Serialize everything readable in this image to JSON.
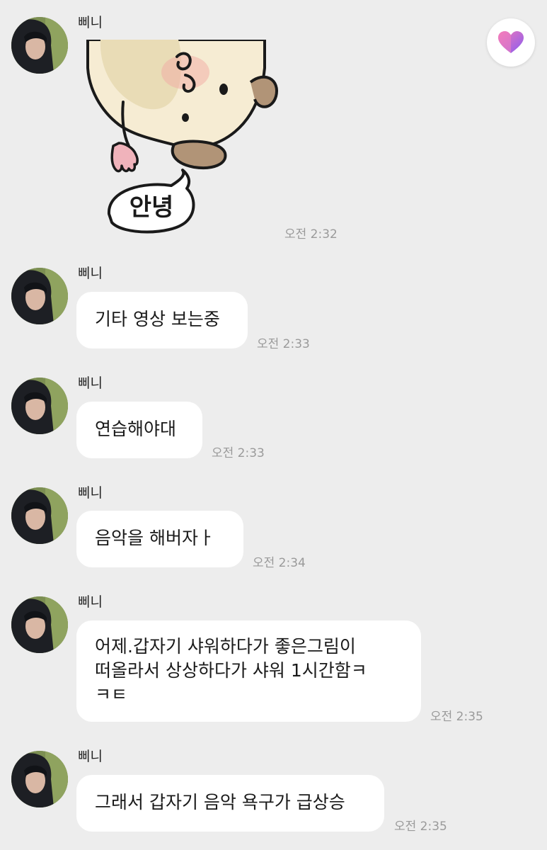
{
  "messages": [
    {
      "sender": "삐니",
      "type": "sticker",
      "sticker_text": "안녕",
      "time": "오전 2:32"
    },
    {
      "sender": "삐니",
      "type": "text",
      "text": "기타 영상 보는중",
      "time": "오전 2:33"
    },
    {
      "sender": "삐니",
      "type": "text",
      "text": "연습해야대",
      "time": "오전 2:33"
    },
    {
      "sender": "삐니",
      "type": "text",
      "text": "음악을 해버자ㅏ",
      "time": "오전 2:34"
    },
    {
      "sender": "삐니",
      "type": "text",
      "lines": [
        "어제.갑자기 샤워하다가 좋은그림이",
        "떠올라서 상상하다가 샤워 1시간함ㅋ",
        "ㅋㅌ"
      ],
      "time": "오전 2:35"
    },
    {
      "sender": "삐니",
      "type": "text",
      "text": "그래서 갑자기 음악 욕구가 급상승",
      "time": "오전 2:35"
    }
  ],
  "icons": {
    "reaction_button": "heart-icon",
    "avatar": "profile-photo"
  },
  "colors": {
    "background": "#ededed",
    "bubble": "#ffffff",
    "time": "#9a9a9a",
    "heart_start": "#f06ab0",
    "heart_end": "#8d5cf0"
  }
}
